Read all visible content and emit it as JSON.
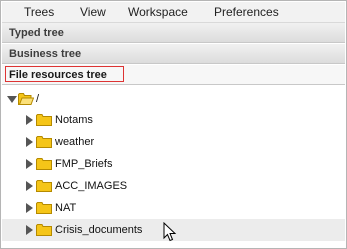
{
  "menu": {
    "items": [
      {
        "label": "Trees"
      },
      {
        "label": "View"
      },
      {
        "label": "Workspace"
      },
      {
        "label": "Preferences"
      }
    ]
  },
  "accordion": {
    "typed": {
      "label": "Typed tree"
    },
    "business": {
      "label": "Business tree"
    },
    "file": {
      "label": "File resources tree"
    }
  },
  "tree": {
    "root": {
      "label": "/"
    },
    "children": [
      {
        "label": "Notams"
      },
      {
        "label": "weather"
      },
      {
        "label": "FMP_Briefs"
      },
      {
        "label": "ACC_IMAGES"
      },
      {
        "label": "NAT"
      },
      {
        "label": "Crisis_documents"
      }
    ]
  },
  "colors": {
    "folder_fill": "#f5c518",
    "folder_stroke": "#b58a00",
    "highlight_border": "#dd3333"
  }
}
